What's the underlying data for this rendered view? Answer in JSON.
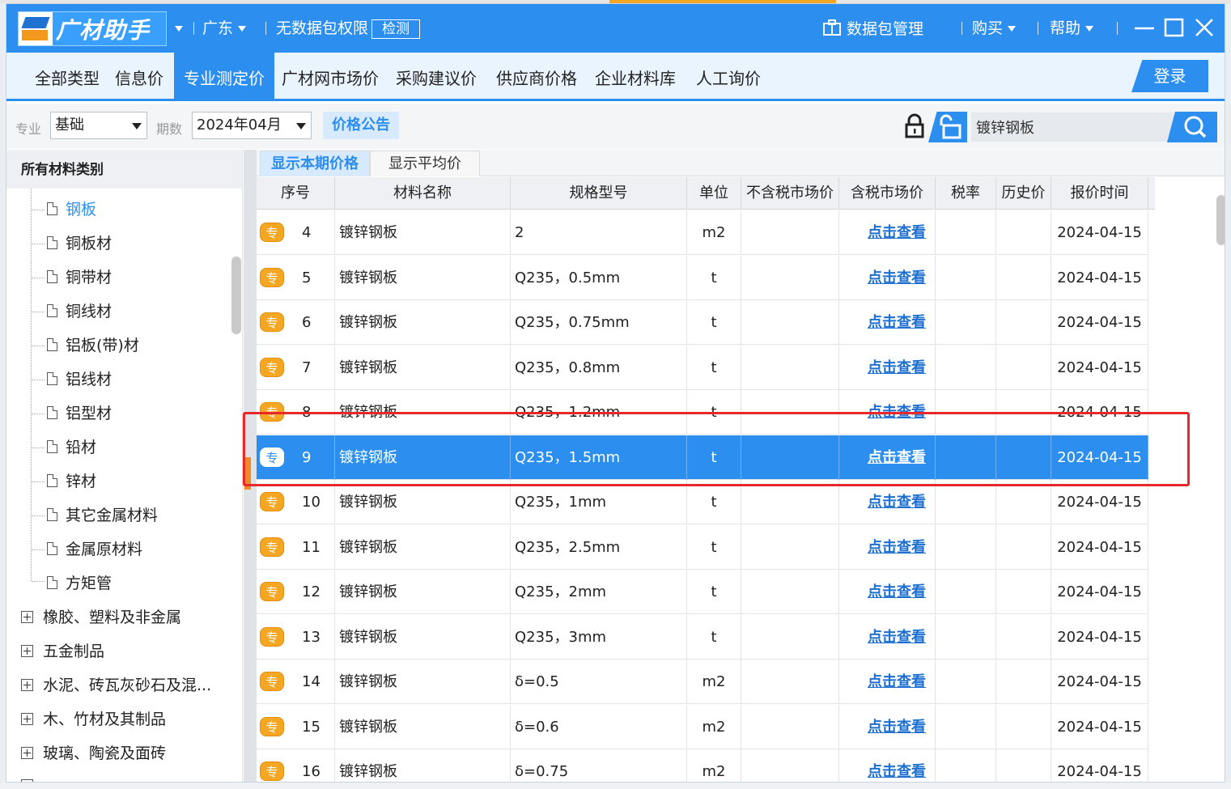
{
  "titlebar": {
    "logo_text": "广材助手",
    "region": "广东",
    "permission_text": "无数据包权限",
    "check_label": "检测",
    "package_mgmt": "数据包管理",
    "buy": "购买",
    "help": "帮助"
  },
  "nav": {
    "tabs": [
      "全部类型",
      "信息价",
      "专业测定价",
      "广材网市场价",
      "采购建议价",
      "供应商价格",
      "企业材料库",
      "人工询价"
    ],
    "active_index": 2,
    "login": "登录"
  },
  "filter": {
    "major_label": "专业",
    "major_value": "基础",
    "period_label": "期数",
    "period_value": "2024年04月",
    "notice_btn": "价格公告",
    "search_value": "镀锌钢板"
  },
  "sidebar": {
    "header": "所有材料类别",
    "children": [
      "钢板",
      "铜板材",
      "铜带材",
      "铜线材",
      "铝板(带)材",
      "铝线材",
      "铝型材",
      "铅材",
      "锌材",
      "其它金属材料",
      "金属原材料",
      "方矩管"
    ],
    "selected_child": 0,
    "categories": [
      "橡胶、塑料及非金属",
      "五金制品",
      "水泥、砖瓦灰砂石及混...",
      "木、竹材及其制品",
      "玻璃、陶瓷及面砖"
    ]
  },
  "subtabs": [
    "显示本期价格",
    "显示平均价"
  ],
  "table": {
    "columns": [
      "序号",
      "材料名称",
      "规格型号",
      "单位",
      "不含税市场价",
      "含税市场价",
      "税率",
      "历史价",
      "报价时间"
    ],
    "badge": "专",
    "link_text": "点击查看",
    "selected_row": 5,
    "rows": [
      {
        "no": "4",
        "name": "镀锌钢板",
        "spec": "2",
        "unit": "m2",
        "date": "2024-04-15"
      },
      {
        "no": "5",
        "name": "镀锌钢板",
        "spec": "Q235，0.5mm",
        "unit": "t",
        "date": "2024-04-15"
      },
      {
        "no": "6",
        "name": "镀锌钢板",
        "spec": "Q235，0.75mm",
        "unit": "t",
        "date": "2024-04-15"
      },
      {
        "no": "7",
        "name": "镀锌钢板",
        "spec": "Q235，0.8mm",
        "unit": "t",
        "date": "2024-04-15"
      },
      {
        "no": "8",
        "name": "镀锌钢板",
        "spec": "Q235，1.2mm",
        "unit": "t",
        "date": "2024-04-15"
      },
      {
        "no": "9",
        "name": "镀锌钢板",
        "spec": "Q235，1.5mm",
        "unit": "t",
        "date": "2024-04-15"
      },
      {
        "no": "10",
        "name": "镀锌钢板",
        "spec": "Q235，1mm",
        "unit": "t",
        "date": "2024-04-15"
      },
      {
        "no": "11",
        "name": "镀锌钢板",
        "spec": "Q235，2.5mm",
        "unit": "t",
        "date": "2024-04-15"
      },
      {
        "no": "12",
        "name": "镀锌钢板",
        "spec": "Q235，2mm",
        "unit": "t",
        "date": "2024-04-15"
      },
      {
        "no": "13",
        "name": "镀锌钢板",
        "spec": "Q235，3mm",
        "unit": "t",
        "date": "2024-04-15"
      },
      {
        "no": "14",
        "name": "镀锌钢板",
        "spec": "δ=0.5",
        "unit": "m2",
        "date": "2024-04-15"
      },
      {
        "no": "15",
        "name": "镀锌钢板",
        "spec": "δ=0.6",
        "unit": "m2",
        "date": "2024-04-15"
      },
      {
        "no": "16",
        "name": "镀锌钢板",
        "spec": "δ=0.75",
        "unit": "m2",
        "date": "2024-04-15"
      }
    ]
  },
  "colors": {
    "primary": "#2c8ff0",
    "badge": "#f5a623",
    "highlight_box": "#e8282b",
    "link": "#1d6fd0"
  }
}
